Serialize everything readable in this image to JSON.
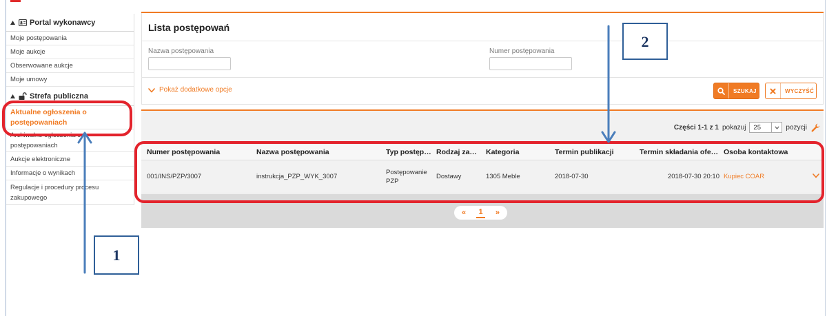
{
  "theme": {
    "accent_color": "#f07b24",
    "annotation_arrow_color": "#4a7ebb",
    "annotation_box_color": "#2f5f98",
    "highlight_color": "#e3232c"
  },
  "sidebar": {
    "sections": [
      {
        "title": "Portal wykonawcy",
        "toggle_icon": "collapse-triangle-icon",
        "icon": "id-card-icon",
        "items": [
          {
            "label": "Moje postępowania"
          },
          {
            "label": "Moje aukcje"
          },
          {
            "label": "Obserwowane aukcje"
          },
          {
            "label": "Moje umowy"
          }
        ]
      },
      {
        "title": "Strefa publiczna",
        "toggle_icon": "collapse-triangle-icon",
        "icon": "unlock-icon",
        "items": [
          {
            "label": "Aktualne ogłoszenia o postępowaniach",
            "active": true
          },
          {
            "label": "Archiwalne ogłoszenia o postępowaniach"
          },
          {
            "label": "Aukcje elektroniczne"
          },
          {
            "label": "Informacje o wynikach"
          },
          {
            "label": "Regulacje i procedury procesu zakupowego"
          }
        ]
      }
    ]
  },
  "main": {
    "title": "Lista postępowań",
    "filters": {
      "name": {
        "label": "Nazwa postępowania",
        "value": ""
      },
      "number": {
        "label": "Numer postępowania",
        "value": ""
      }
    },
    "more_options": {
      "label": "Pokaż dodatkowe opcje",
      "icon": "chevron-down-icon"
    },
    "search_button": {
      "label": "SZUKAJ",
      "icon": "search-icon"
    },
    "clear_button": {
      "label": "WYCZYŚĆ",
      "icon": "close-icon"
    },
    "results": {
      "range": "Części 1-1 z 1",
      "show_label": "pokazuj",
      "page_size": "25",
      "items_label": "pozycji",
      "settings_icon": "wrench-icon",
      "columns": [
        "Numer postępowania",
        "Nazwa postępowania",
        "Typ postęp…",
        "Rodzaj za…",
        "Kategoria",
        "Termin publikacji",
        "Termin składania ofe…",
        "Osoba kontaktowa"
      ],
      "rows": [
        {
          "number": "001/INS/PZP/3007",
          "name": "instrukcja_PZP_WYK_3007",
          "type": "Postępowanie PZP",
          "kind": "Dostawy",
          "category": "1305 Meble",
          "published": "2018-07-30",
          "deadline": "2018-07-30 20:10",
          "contact": "Kupiec COAR",
          "action_icon": "chevron-down-icon"
        }
      ]
    },
    "pager": {
      "prev": "«",
      "current": "1",
      "next": "»"
    }
  },
  "annotations": [
    {
      "label": "1"
    },
    {
      "label": "2"
    }
  ]
}
